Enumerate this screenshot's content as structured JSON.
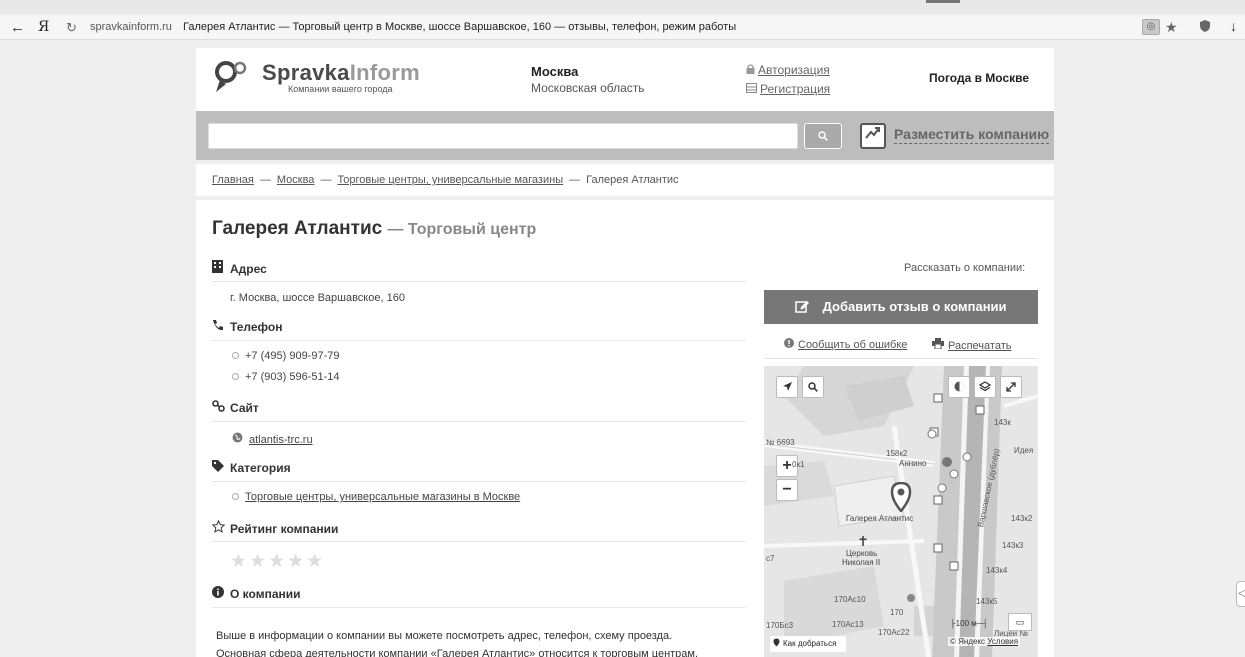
{
  "browser": {
    "back": "←",
    "ya": "Я",
    "reload": "↻",
    "domain": "spravkainform.ru",
    "title": "Галерея Атлантис — Торговый центр в Москве, шоссе Варшавское, 160 — отзывы, телефон, режим работы",
    "ext_label": "◎",
    "star": "★",
    "download": "↓"
  },
  "header": {
    "brand_main": "Spravka",
    "brand_accent": "Inform",
    "tagline": "Компании вашего города",
    "city": "Москва",
    "region": "Московская область",
    "login": "Авторизация",
    "register": "Регистрация",
    "weather": "Погода в Москве"
  },
  "search": {
    "value": "",
    "placeholder": "",
    "button": "🔍",
    "add_company": "Разместить компанию"
  },
  "breadcrumbs": {
    "home": "Главная",
    "city": "Москва",
    "category": "Торговые центры, универсальные магазины",
    "current": "Галерея Атлантис",
    "separator": "—"
  },
  "company": {
    "name": "Галерея Атлантис",
    "type": "— Торговый центр",
    "address_label": "Адрес",
    "address": "г. Москва, шоссе Варшавское, 160",
    "phone_label": "Телефон",
    "phones": [
      "+7 (495) 909-97-79",
      "+7 (903) 596-51-14"
    ],
    "site_label": "Сайт",
    "site": "atlantis-trc.ru",
    "category_label": "Категория",
    "category": "Торговые центры, универсальные магазины в Москве",
    "rating_label": "Рейтинг компании",
    "rating_stars": "★★★★★",
    "rating_value": 0,
    "about_label": "О компании",
    "about_line1": "Выше в информации о компании вы можете посмотреть адрес, телефон, схему проезда.",
    "about_line2": "Основная сфера деятельности компании «Галерея Атлантис» относится к торговым центрам,"
  },
  "sidebar": {
    "tell": "Рассказать о компании:",
    "add_review": "Добавить отзыв о компании",
    "report_error": "Сообщить об ошибке",
    "print": "Распечатать"
  },
  "map": {
    "labels": {
      "annino": "Аннино",
      "gallery": "Галерея Атлантис",
      "church": "Церковь",
      "church2": "Николая II",
      "road": "Варшавское (дублёр)",
      "b158": "158к2",
      "b143k": "143к",
      "b143k2": "143к2",
      "b143k3": "143к3",
      "b143k4": "143к4",
      "b143k5": "143к5",
      "b170ac10": "170Ас10",
      "b170ac13": "170Ас13",
      "b170ac22": "170Ас22",
      "b170bc3": "170Бс3",
      "b170": "170",
      "c7": "с7",
      "n6693": "№ 6693",
      "idea": "Идея",
      "litsey": "Лицей №",
      "k1": "0к1"
    },
    "route": "Как добраться",
    "scale": "100 м",
    "copyright": "© Яндекс",
    "terms": "Условия",
    "zoom_in": "+",
    "zoom_out": "−"
  }
}
